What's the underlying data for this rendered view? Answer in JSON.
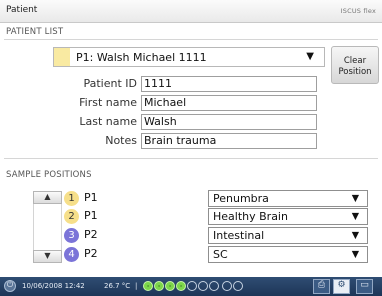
{
  "window": {
    "title": "Patient",
    "brand": "ISCUS flex"
  },
  "patient_list": {
    "heading": "PATIENT LIST",
    "selected_patient": "P1: Walsh Michael 1111",
    "swatch_color": "#f9eaa2",
    "clear_button": {
      "line1": "Clear",
      "line2": "Position"
    }
  },
  "fields": {
    "patient_id": {
      "label": "Patient ID",
      "value": "1111"
    },
    "first_name": {
      "label": "First name",
      "value": "Michael"
    },
    "last_name": {
      "label": "Last name",
      "value": "Walsh"
    },
    "notes": {
      "label": "Notes",
      "value": "Brain trauma"
    }
  },
  "sample_positions": {
    "heading": "SAMPLE POSITIONS",
    "rows": [
      {
        "num": "1",
        "name": "P1",
        "region": "Penumbra",
        "color": "#f6df8a",
        "text_color": "#333333"
      },
      {
        "num": "2",
        "name": "P1",
        "region": "Healthy Brain",
        "color": "#f6df8a",
        "text_color": "#333333"
      },
      {
        "num": "3",
        "name": "P2",
        "region": "Intestinal",
        "color": "#7b74d8",
        "text_color": "#ffffff"
      },
      {
        "num": "4",
        "name": "P2",
        "region": "SC",
        "color": "#7b74d8",
        "text_color": "#ffffff"
      }
    ]
  },
  "status_bar": {
    "datetime": "10/06/2008 12:42",
    "temperature": "26.7 °C",
    "separator": "|",
    "vial_dots": [
      "on",
      "on",
      "on",
      "on",
      "off",
      "off",
      "off",
      "off",
      "off"
    ],
    "icons": [
      "power-icon",
      "printer-icon",
      "settings-icon",
      "screen-icon"
    ]
  }
}
